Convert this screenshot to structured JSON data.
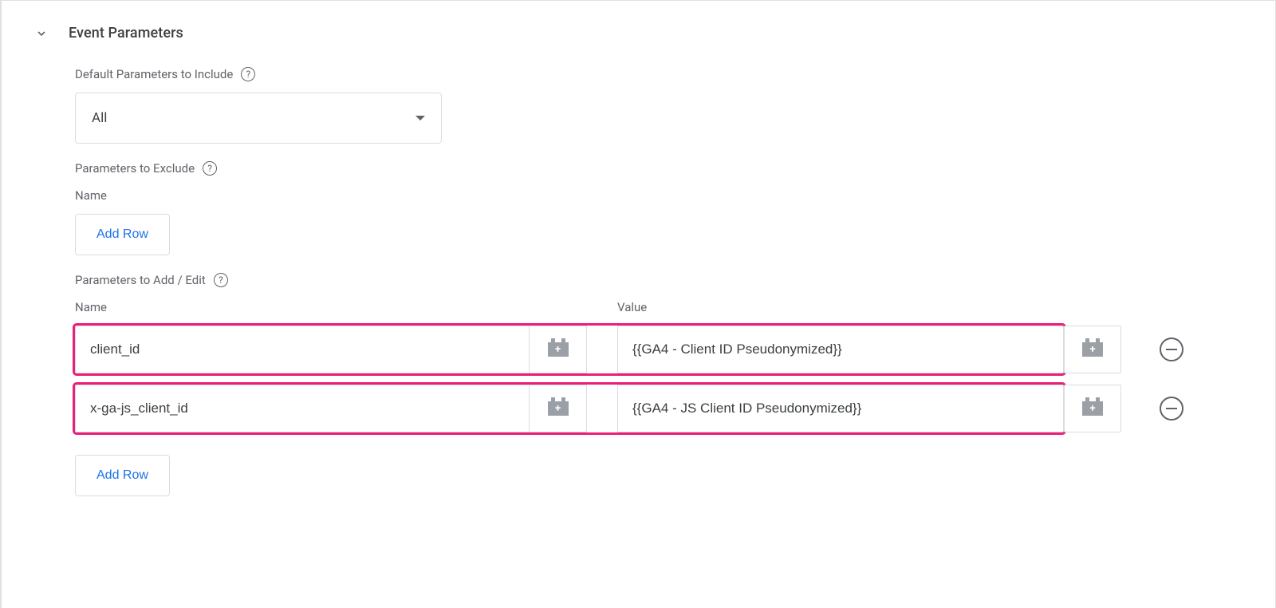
{
  "section": {
    "title": "Event Parameters",
    "defaultParamsLabel": "Default Parameters to Include",
    "defaultParamsValue": "All",
    "excludeLabel": "Parameters to Exclude",
    "nameLabel": "Name",
    "valueLabel": "Value",
    "addRowLabel": "Add Row",
    "addEditLabel": "Parameters to Add / Edit"
  },
  "paramsToAdd": [
    {
      "name": "client_id",
      "value": "{{GA4 - Client ID Pseudonymized}}"
    },
    {
      "name": "x-ga-js_client_id",
      "value": "{{GA4 - JS Client ID Pseudonymized}}"
    }
  ]
}
